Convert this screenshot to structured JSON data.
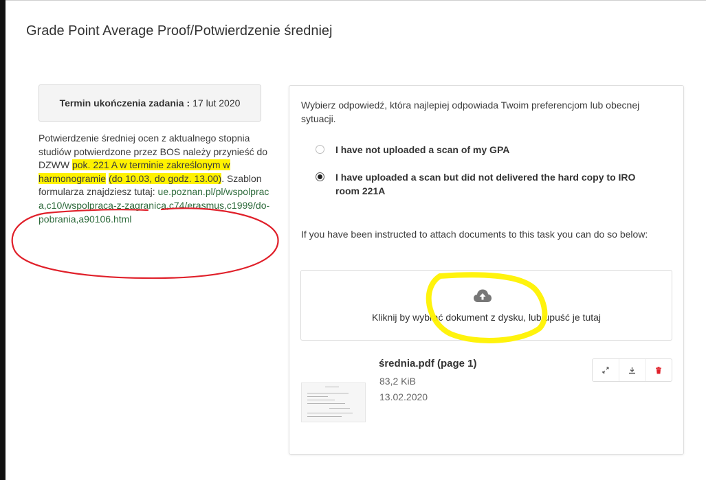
{
  "page": {
    "title": "Grade Point Average Proof/Potwierdzenie średniej"
  },
  "deadline": {
    "label": "Termin ukończenia zadania :",
    "date": "17 lut 2020"
  },
  "description": {
    "part1": "Potwierdzenie średniej ocen z aktualnego stopnia studiów potwierdzone przez BOS należy przynieść do DZWW ",
    "highlight1": "pok. 221 A w terminie zakreślonym w harmonogramie",
    "space": " ",
    "highlight2": "(do 10.03, do godz. 13.00)",
    "part2": ". Szablon formularza znajdziesz tutaj: ",
    "link": "ue.poznan.pl/pl/wspolpraca,c10/wspolpraca-z-zagranica,c74/erasmus,c1999/do-pobrania,a90106.html"
  },
  "question": {
    "prompt": "Wybierz odpowiedź, która najlepiej odpowiada Twoim preferencjom lub obecnej sytuacji.",
    "options": [
      {
        "label": "I have not uploaded a scan of my GPA",
        "selected": false
      },
      {
        "label": "I have uploaded a scan but did not delivered the hard copy to IRO room 221A",
        "selected": true
      }
    ]
  },
  "attachments": {
    "note": "If you have been instructed to attach documents to this task you can do so below:",
    "dropzone_text": "Kliknij by wybrać dokument z dysku, lub upuść je tutaj",
    "file": {
      "name": "średnia.pdf (page 1)",
      "size": "83,2 KiB",
      "date": "13.02.2020"
    }
  },
  "colors": {
    "highlight": "#fff200",
    "annotation_red": "#e0202a",
    "link": "#2e6b3c",
    "delete": "#e0202a"
  }
}
